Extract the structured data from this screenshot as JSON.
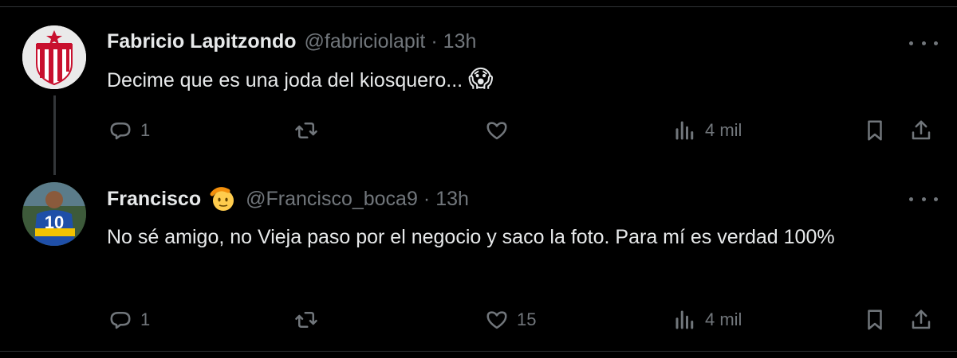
{
  "tweets": [
    {
      "name": "Fabricio Lapitzondo",
      "handle": "@fabriciolapit",
      "time": "13h",
      "text": "Decime que es una joda del kiosquero...",
      "emoji": "😱",
      "replies": "1",
      "retweets": "",
      "likes": "",
      "views": "4 mil"
    },
    {
      "name": "Francisco",
      "name_badge_emoji": "🫡",
      "handle": "@Francisco_boca9",
      "time": "13h",
      "text": "No sé amigo, no Vieja paso por el negocio y saco la foto. Para mí es verdad 100%",
      "replies": "1",
      "retweets": "",
      "likes": "15",
      "views": "4 mil"
    }
  ],
  "separator": "·"
}
